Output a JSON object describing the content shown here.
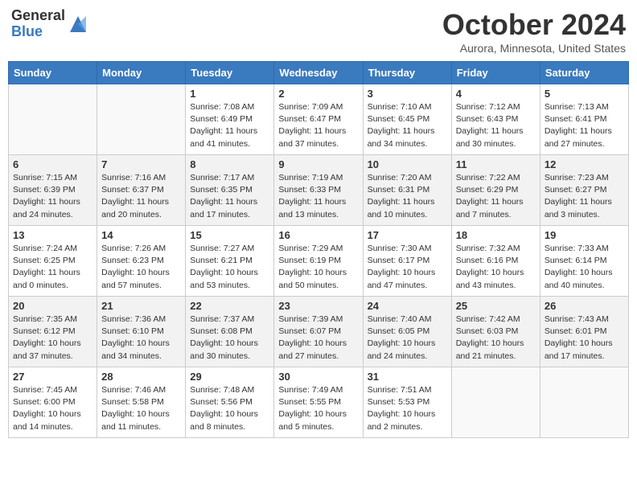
{
  "header": {
    "logo_general": "General",
    "logo_blue": "Blue",
    "title": "October 2024",
    "location": "Aurora, Minnesota, United States"
  },
  "weekdays": [
    "Sunday",
    "Monday",
    "Tuesday",
    "Wednesday",
    "Thursday",
    "Friday",
    "Saturday"
  ],
  "weeks": [
    [
      {
        "day": "",
        "sunrise": "",
        "sunset": "",
        "daylight": ""
      },
      {
        "day": "",
        "sunrise": "",
        "sunset": "",
        "daylight": ""
      },
      {
        "day": "1",
        "sunrise": "Sunrise: 7:08 AM",
        "sunset": "Sunset: 6:49 PM",
        "daylight": "Daylight: 11 hours and 41 minutes."
      },
      {
        "day": "2",
        "sunrise": "Sunrise: 7:09 AM",
        "sunset": "Sunset: 6:47 PM",
        "daylight": "Daylight: 11 hours and 37 minutes."
      },
      {
        "day": "3",
        "sunrise": "Sunrise: 7:10 AM",
        "sunset": "Sunset: 6:45 PM",
        "daylight": "Daylight: 11 hours and 34 minutes."
      },
      {
        "day": "4",
        "sunrise": "Sunrise: 7:12 AM",
        "sunset": "Sunset: 6:43 PM",
        "daylight": "Daylight: 11 hours and 30 minutes."
      },
      {
        "day": "5",
        "sunrise": "Sunrise: 7:13 AM",
        "sunset": "Sunset: 6:41 PM",
        "daylight": "Daylight: 11 hours and 27 minutes."
      }
    ],
    [
      {
        "day": "6",
        "sunrise": "Sunrise: 7:15 AM",
        "sunset": "Sunset: 6:39 PM",
        "daylight": "Daylight: 11 hours and 24 minutes."
      },
      {
        "day": "7",
        "sunrise": "Sunrise: 7:16 AM",
        "sunset": "Sunset: 6:37 PM",
        "daylight": "Daylight: 11 hours and 20 minutes."
      },
      {
        "day": "8",
        "sunrise": "Sunrise: 7:17 AM",
        "sunset": "Sunset: 6:35 PM",
        "daylight": "Daylight: 11 hours and 17 minutes."
      },
      {
        "day": "9",
        "sunrise": "Sunrise: 7:19 AM",
        "sunset": "Sunset: 6:33 PM",
        "daylight": "Daylight: 11 hours and 13 minutes."
      },
      {
        "day": "10",
        "sunrise": "Sunrise: 7:20 AM",
        "sunset": "Sunset: 6:31 PM",
        "daylight": "Daylight: 11 hours and 10 minutes."
      },
      {
        "day": "11",
        "sunrise": "Sunrise: 7:22 AM",
        "sunset": "Sunset: 6:29 PM",
        "daylight": "Daylight: 11 hours and 7 minutes."
      },
      {
        "day": "12",
        "sunrise": "Sunrise: 7:23 AM",
        "sunset": "Sunset: 6:27 PM",
        "daylight": "Daylight: 11 hours and 3 minutes."
      }
    ],
    [
      {
        "day": "13",
        "sunrise": "Sunrise: 7:24 AM",
        "sunset": "Sunset: 6:25 PM",
        "daylight": "Daylight: 11 hours and 0 minutes."
      },
      {
        "day": "14",
        "sunrise": "Sunrise: 7:26 AM",
        "sunset": "Sunset: 6:23 PM",
        "daylight": "Daylight: 10 hours and 57 minutes."
      },
      {
        "day": "15",
        "sunrise": "Sunrise: 7:27 AM",
        "sunset": "Sunset: 6:21 PM",
        "daylight": "Daylight: 10 hours and 53 minutes."
      },
      {
        "day": "16",
        "sunrise": "Sunrise: 7:29 AM",
        "sunset": "Sunset: 6:19 PM",
        "daylight": "Daylight: 10 hours and 50 minutes."
      },
      {
        "day": "17",
        "sunrise": "Sunrise: 7:30 AM",
        "sunset": "Sunset: 6:17 PM",
        "daylight": "Daylight: 10 hours and 47 minutes."
      },
      {
        "day": "18",
        "sunrise": "Sunrise: 7:32 AM",
        "sunset": "Sunset: 6:16 PM",
        "daylight": "Daylight: 10 hours and 43 minutes."
      },
      {
        "day": "19",
        "sunrise": "Sunrise: 7:33 AM",
        "sunset": "Sunset: 6:14 PM",
        "daylight": "Daylight: 10 hours and 40 minutes."
      }
    ],
    [
      {
        "day": "20",
        "sunrise": "Sunrise: 7:35 AM",
        "sunset": "Sunset: 6:12 PM",
        "daylight": "Daylight: 10 hours and 37 minutes."
      },
      {
        "day": "21",
        "sunrise": "Sunrise: 7:36 AM",
        "sunset": "Sunset: 6:10 PM",
        "daylight": "Daylight: 10 hours and 34 minutes."
      },
      {
        "day": "22",
        "sunrise": "Sunrise: 7:37 AM",
        "sunset": "Sunset: 6:08 PM",
        "daylight": "Daylight: 10 hours and 30 minutes."
      },
      {
        "day": "23",
        "sunrise": "Sunrise: 7:39 AM",
        "sunset": "Sunset: 6:07 PM",
        "daylight": "Daylight: 10 hours and 27 minutes."
      },
      {
        "day": "24",
        "sunrise": "Sunrise: 7:40 AM",
        "sunset": "Sunset: 6:05 PM",
        "daylight": "Daylight: 10 hours and 24 minutes."
      },
      {
        "day": "25",
        "sunrise": "Sunrise: 7:42 AM",
        "sunset": "Sunset: 6:03 PM",
        "daylight": "Daylight: 10 hours and 21 minutes."
      },
      {
        "day": "26",
        "sunrise": "Sunrise: 7:43 AM",
        "sunset": "Sunset: 6:01 PM",
        "daylight": "Daylight: 10 hours and 17 minutes."
      }
    ],
    [
      {
        "day": "27",
        "sunrise": "Sunrise: 7:45 AM",
        "sunset": "Sunset: 6:00 PM",
        "daylight": "Daylight: 10 hours and 14 minutes."
      },
      {
        "day": "28",
        "sunrise": "Sunrise: 7:46 AM",
        "sunset": "Sunset: 5:58 PM",
        "daylight": "Daylight: 10 hours and 11 minutes."
      },
      {
        "day": "29",
        "sunrise": "Sunrise: 7:48 AM",
        "sunset": "Sunset: 5:56 PM",
        "daylight": "Daylight: 10 hours and 8 minutes."
      },
      {
        "day": "30",
        "sunrise": "Sunrise: 7:49 AM",
        "sunset": "Sunset: 5:55 PM",
        "daylight": "Daylight: 10 hours and 5 minutes."
      },
      {
        "day": "31",
        "sunrise": "Sunrise: 7:51 AM",
        "sunset": "Sunset: 5:53 PM",
        "daylight": "Daylight: 10 hours and 2 minutes."
      },
      {
        "day": "",
        "sunrise": "",
        "sunset": "",
        "daylight": ""
      },
      {
        "day": "",
        "sunrise": "",
        "sunset": "",
        "daylight": ""
      }
    ]
  ]
}
